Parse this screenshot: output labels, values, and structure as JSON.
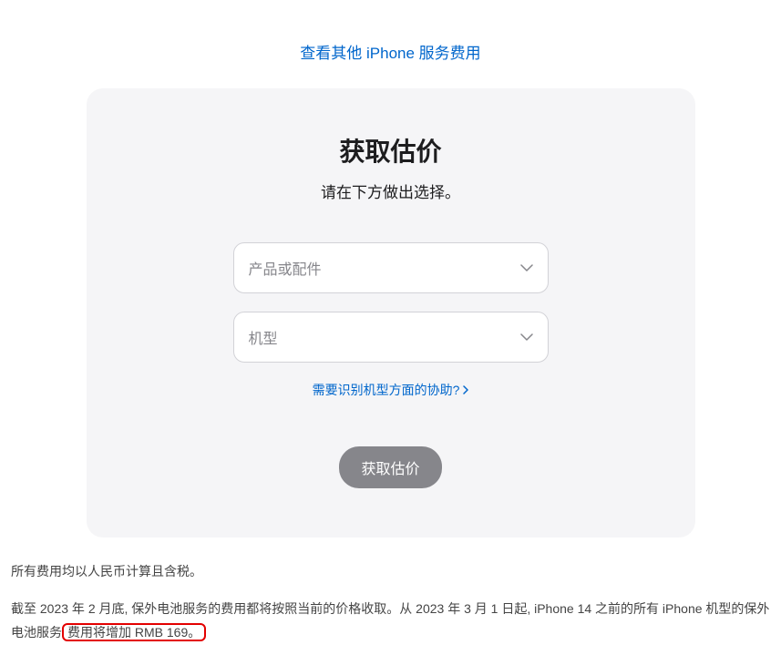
{
  "top_link": {
    "text": "查看其他 iPhone 服务费用"
  },
  "card": {
    "title": "获取估价",
    "subtitle": "请在下方做出选择。",
    "select_product": {
      "placeholder": "产品或配件"
    },
    "select_model": {
      "placeholder": "机型"
    },
    "help_link": {
      "text": "需要识别机型方面的协助?"
    },
    "submit_button": {
      "label": "获取估价"
    }
  },
  "footer": {
    "line1": "所有费用均以人民币计算且含税。",
    "line2_part1": "截至 2023 年 2 月底, 保外电池服务的费用都将按照当前的价格收取。从 2023 年 3 月 1 日起, iPhone 14 之前的所有 iPhone 机型的保外电池服务",
    "line2_highlight": "费用将增加 RMB 169。"
  }
}
